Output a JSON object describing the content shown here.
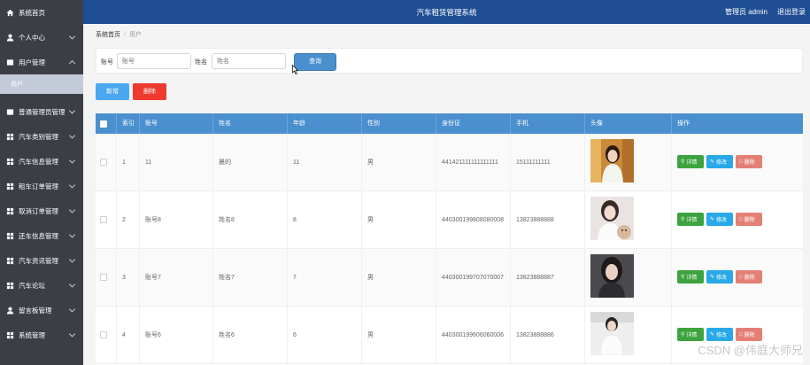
{
  "app": {
    "title": "汽车租赁管理系统",
    "user_label": "管理员 admin",
    "logout_label": "退出登录"
  },
  "sidebar": {
    "items": [
      {
        "label": "系统首页",
        "icon": "home-icon"
      },
      {
        "label": "个人中心",
        "icon": "user-icon"
      },
      {
        "label": "用户管理",
        "icon": "list-icon",
        "expanded": true
      },
      {
        "label": "普通管理员管理",
        "icon": "list-icon"
      },
      {
        "label": "汽车类别管理",
        "icon": "grid-icon"
      },
      {
        "label": "汽车信息管理",
        "icon": "grid-icon"
      },
      {
        "label": "租车订单管理",
        "icon": "grid-icon"
      },
      {
        "label": "取消订单管理",
        "icon": "grid-icon"
      },
      {
        "label": "还车信息管理",
        "icon": "grid-icon"
      },
      {
        "label": "汽车资讯管理",
        "icon": "grid-icon"
      },
      {
        "label": "汽车论坛",
        "icon": "grid-icon"
      },
      {
        "label": "留言板管理",
        "icon": "user-icon"
      },
      {
        "label": "系统管理",
        "icon": "grid-icon"
      }
    ],
    "sub_item": "用户"
  },
  "breadcrumb": {
    "home": "系统首页",
    "current": "用户"
  },
  "search": {
    "account_label": "账号",
    "account_placeholder": "账号",
    "name_label": "姓名",
    "name_placeholder": "姓名",
    "query_label": "查询"
  },
  "actions": {
    "add_label": "新增",
    "delete_label": "删除"
  },
  "table": {
    "columns": [
      "索引",
      "账号",
      "姓名",
      "年龄",
      "性别",
      "身份证",
      "手机",
      "头像",
      "操作"
    ],
    "rows": [
      {
        "index": "1",
        "account": "11",
        "name": "晨的",
        "age": "11",
        "gender": "男",
        "id_card": "441421111111111111",
        "phone": "15111111111"
      },
      {
        "index": "2",
        "account": "账号8",
        "name": "姓名8",
        "age": "8",
        "gender": "男",
        "id_card": "440300199808080008",
        "phone": "13823888888"
      },
      {
        "index": "3",
        "account": "账号7",
        "name": "姓名7",
        "age": "7",
        "gender": "男",
        "id_card": "440300199707070007",
        "phone": "13823888887"
      },
      {
        "index": "4",
        "account": "账号6",
        "name": "姓名6",
        "age": "6",
        "gender": "男",
        "id_card": "440300199606060006",
        "phone": "13823888886"
      }
    ],
    "op_detail": "详情",
    "op_edit": "修改",
    "op_delete": "删除"
  },
  "colors": {
    "sidebar_bg": "#3b3f45",
    "header_bg": "#1f4e94",
    "table_header": "#4a8fce",
    "add_button": "#4aa8f0",
    "delete_button": "#ee3a2f",
    "detail_button": "#3ca33e",
    "edit_button": "#28a9e8",
    "remove_button": "#e47f75"
  },
  "watermark": "CSDN @伟庭大师兄"
}
